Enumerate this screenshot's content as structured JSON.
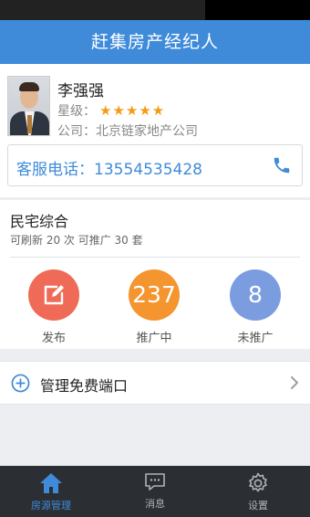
{
  "header": {
    "title": "赶集房产经纪人"
  },
  "profile": {
    "name": "李强强",
    "rating_label": "星级：",
    "stars": 5,
    "stars_display": "★★★★★",
    "company_label": "公司：",
    "company": "北京链家地产公司",
    "hotline_text": "客服电话：13554535428"
  },
  "plan": {
    "title": "民宅综合",
    "subtitle": "可刷新 20 次 可推广 30 套",
    "stats": {
      "publish_label": "发布",
      "promoting_value": "237",
      "promoting_label": "推广中",
      "unpromoted_value": "8",
      "unpromoted_label": "未推广"
    }
  },
  "manage": {
    "label": "管理免费端口"
  },
  "tabs": {
    "home": "房源管理",
    "messages": "消息",
    "settings": "设置"
  },
  "colors": {
    "primary": "#3f8bd9",
    "publish": "#ef6b57",
    "promoting": "#f5952f",
    "unpromoted": "#7b9de0",
    "star": "#f39c12",
    "tabbar": "#2b2e33"
  },
  "icons": {
    "phone": "phone-icon",
    "edit": "edit-icon",
    "add": "plus-circle-icon",
    "chevron": "chevron-right-icon",
    "home": "home-icon",
    "message": "chat-icon",
    "settings": "gear-icon"
  }
}
